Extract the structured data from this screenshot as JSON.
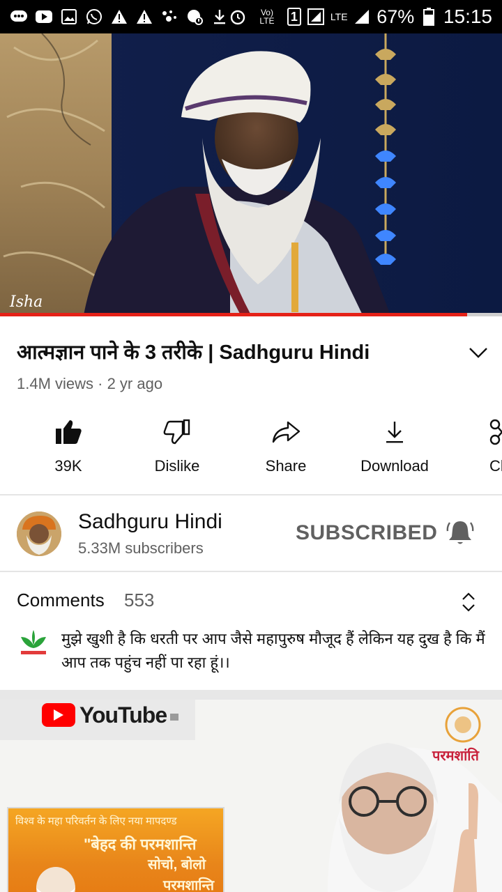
{
  "status_bar": {
    "network": "Vo) LTE",
    "sim": "1",
    "lte": "LTE",
    "battery": "67%",
    "time": "15:15"
  },
  "player": {
    "watermark": "Isha",
    "progress_fraction": 0.93
  },
  "video": {
    "title": "आत्मज्ञान पाने के 3 तरीके | Sadhguru Hindi",
    "meta": "1.4M views · 2 yr ago"
  },
  "actions": [
    {
      "label": "39K",
      "icon": "thumbs-up-icon"
    },
    {
      "label": "Dislike",
      "icon": "thumbs-down-icon"
    },
    {
      "label": "Share",
      "icon": "share-icon"
    },
    {
      "label": "Download",
      "icon": "download-icon"
    },
    {
      "label": "Cl",
      "icon": "clip-icon"
    }
  ],
  "channel": {
    "name": "Sadhguru Hindi",
    "subscribers": "5.33M subscribers",
    "subscribe_label": "SUBSCRIBED"
  },
  "comments": {
    "title": "Comments",
    "count": "553",
    "top_comment": "मुझे खुशी है कि धरती पर आप जैसे महापुरुष मौजूद हैं लेकिन यह दुख है कि मैं आप तक पहुंच नहीं पा रहा हूं।।"
  },
  "next_video": {
    "yt_word": "YouTube",
    "brand": "परमशांति",
    "banner_lines": [
      "विश्व के महा परिवर्तन के लिए नया मापदण्ड",
      "\"बेहद की परमशान्ति",
      "सोचो, बोलो",
      "परमशान्ति"
    ]
  },
  "colors": {
    "accent_red": "#e52117",
    "text_primary": "#0f0f0f",
    "text_secondary": "#606060"
  }
}
